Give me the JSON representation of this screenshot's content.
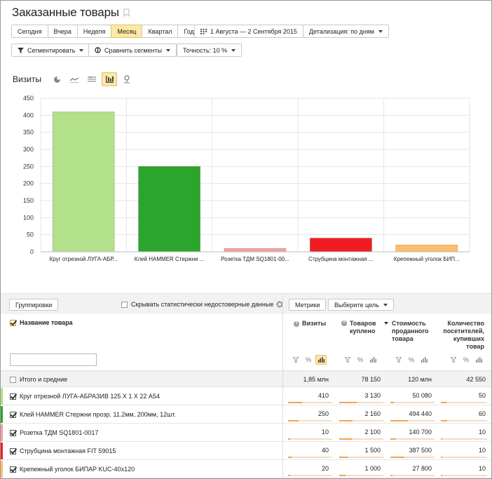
{
  "page": {
    "title": "Заказанные товары"
  },
  "periods": {
    "items": [
      "Сегодня",
      "Вчера",
      "Неделя",
      "Месяц",
      "Квартал",
      "Год"
    ],
    "active_index": 3
  },
  "date_range": "1 Августа — 2 Сентября 2015",
  "detail": "Детализация: по дням",
  "segment_button": "Сегментировать",
  "compare_button": "Сравнить сегменты",
  "accuracy": "Точность: 10 %",
  "chart_title": "Визиты",
  "chart_view_icons": [
    "pie-chart-icon",
    "line-chart-icon",
    "area-chart-icon",
    "bar-chart-icon",
    "map-icon"
  ],
  "chart_data": {
    "type": "bar",
    "title": "",
    "ylabel": "",
    "ylim": [
      0,
      450
    ],
    "yticks": [
      0,
      50,
      100,
      150,
      200,
      250,
      300,
      350,
      400,
      450
    ],
    "grid": true,
    "categories": [
      "Круг отрезной ЛУГА-АБР...",
      "Клей HAMMER Стержни ...",
      "Розетка ТДМ SQ1801-00...",
      "Струбцина монтажная ...",
      "Крепежный уголок БИП..."
    ],
    "values": [
      410,
      250,
      10,
      40,
      20
    ],
    "colors": [
      "#b3e08a",
      "#2ca52c",
      "#f2a0a0",
      "#ef1c24",
      "#fdbe6a"
    ]
  },
  "table": {
    "groups_button": "Группировки",
    "hide_unreliable": "Скрывать статистически недостоверные данные",
    "metrics_button": "Метрики",
    "goal_button": "Выберите цель",
    "name_column": "Название товара",
    "columns": [
      {
        "label": "Визиты",
        "has_info": true,
        "sorted": false
      },
      {
        "label": "Товаров куплено",
        "has_info": true,
        "sorted": true
      },
      {
        "label": "Стоимость проданного товара",
        "has_info": false,
        "sorted": false
      },
      {
        "label": "Количество посетителей, купивших товар",
        "has_info": false,
        "sorted": false
      }
    ],
    "totals": {
      "label": "Итого и средние",
      "values": [
        "1,85 млн",
        "78 150",
        "120 млн",
        "42 550"
      ]
    },
    "rows": [
      {
        "name": "Круг отрезной ЛУГА-АБРАЗИВ 125 Х 1 Х 22 А54",
        "values": [
          "410",
          "3 130",
          "50 080",
          "50"
        ],
        "shares": [
          0.31,
          0.4,
          0.08,
          0.12
        ],
        "color": "#b3e08a"
      },
      {
        "name": "Клей HAMMER Стержни прозр. 11.2мм, 200мм, 12шт.",
        "values": [
          "250",
          "2 160",
          "494 440",
          "60"
        ],
        "shares": [
          0.24,
          0.3,
          0.4,
          0.13
        ],
        "color": "#2ca52c"
      },
      {
        "name": "Розетка ТДМ SQ1801-0017",
        "values": [
          "10",
          "2 100",
          "140 700",
          "10"
        ],
        "shares": [
          0.04,
          0.29,
          0.12,
          0.03
        ],
        "color": "#f2a0a0"
      },
      {
        "name": "Струбцина монтажная FIT 59015",
        "values": [
          "40",
          "1 500",
          "387 500",
          "10"
        ],
        "shares": [
          0.08,
          0.2,
          0.32,
          0.03
        ],
        "color": "#ef1c24"
      },
      {
        "name": "Крепежный уголок БИПАР KUC-40x120",
        "values": [
          "20",
          "1 000",
          "27 800",
          "10"
        ],
        "shares": [
          0.05,
          0.14,
          0.04,
          0.03
        ],
        "color": "#fdbe6a"
      }
    ]
  }
}
